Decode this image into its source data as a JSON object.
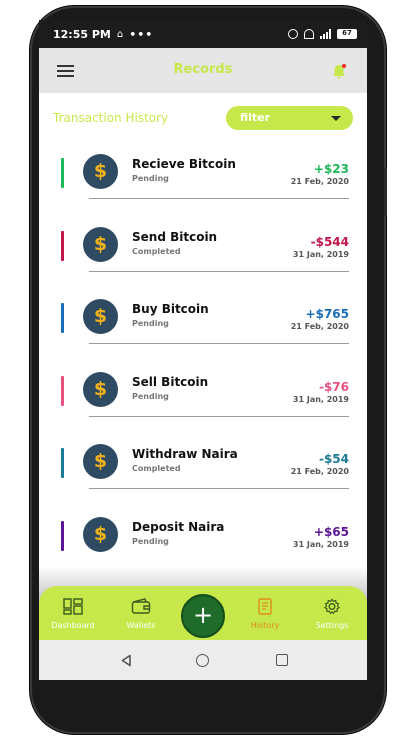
{
  "status_bar": {
    "time": "12:55 PM",
    "dots": "•••",
    "battery": "67"
  },
  "app_bar": {
    "title": "Records",
    "menu_icon": "hamburger-menu-icon",
    "bell_icon": "bell-icon"
  },
  "history": {
    "title": "Transaction History",
    "filter_label": "filter"
  },
  "transactions": [
    {
      "name": "Recieve Bitcoin",
      "status": "Pending",
      "amount": "+$23",
      "date": "21 Feb, 2020",
      "accent": "#1db85a",
      "amount_color": "#1db85a"
    },
    {
      "name": "Send Bitcoin",
      "status": "Completed",
      "amount": "-$544",
      "date": "31 Jan, 2019",
      "accent": "#c0174a",
      "amount_color": "#c0174a"
    },
    {
      "name": "Buy Bitcoin",
      "status": "Pending",
      "amount": "+$765",
      "date": "21 Feb, 2020",
      "accent": "#1a6eb8",
      "amount_color": "#1a6eb8"
    },
    {
      "name": "Sell Bitcoin",
      "status": "Pending",
      "amount": "-$76",
      "date": "31 Jan, 2019",
      "accent": "#e8507e",
      "amount_color": "#e8507e"
    },
    {
      "name": "Withdraw Naira",
      "status": "Completed",
      "amount": "-$54",
      "date": "21 Feb, 2020",
      "accent": "#1a7a96",
      "amount_color": "#1a7a96"
    },
    {
      "name": "Deposit Naira",
      "status": "Pending",
      "amount": "+$65",
      "date": "31 Jan, 2019",
      "accent": "#5b1596",
      "amount_color": "#5b1596"
    }
  ],
  "coin_symbol": "$",
  "bottom_nav": {
    "items": [
      {
        "label": "Dashboard",
        "icon": "dashboard-icon"
      },
      {
        "label": "Wallets",
        "icon": "wallet-icon"
      },
      {
        "label": "History",
        "icon": "history-icon"
      },
      {
        "label": "Settings",
        "icon": "settings-gear-icon"
      }
    ],
    "fab_label": "+"
  },
  "colors": {
    "accent": "#c6e84a",
    "fab": "#1f6b2a",
    "coin_bg": "#2f4a63",
    "coin_symbol": "#f0b21a",
    "active_nav": "#e08a1e"
  }
}
